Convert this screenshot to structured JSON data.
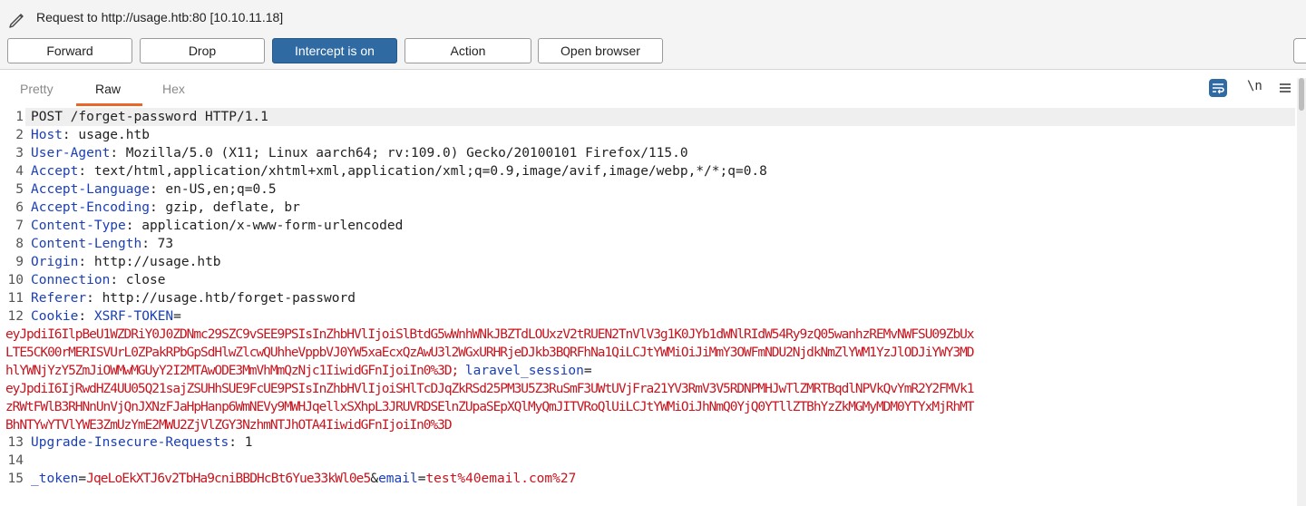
{
  "window": {
    "title": "Request to http://usage.htb:80  [10.10.11.18]"
  },
  "toolbar": {
    "forward": "Forward",
    "drop": "Drop",
    "intercept": "Intercept is on",
    "action": "Action",
    "open_browser": "Open browser"
  },
  "tabs": {
    "pretty": "Pretty",
    "raw": "Raw",
    "hex": "Hex",
    "newline_icon": "\\n",
    "active": "Raw"
  },
  "icons": {
    "pencil": "pencil-icon",
    "wrap": "wrap-text-icon",
    "newline": "newline-icon",
    "menu": "hamburger-menu-icon"
  },
  "colors": {
    "accent": "#e8682b",
    "intercept_bg": "#2f6aa3",
    "header_name": "#1a3fb8",
    "value_red": "#c8141e"
  },
  "request": {
    "line1": "POST /forget-password HTTP/1.1",
    "headers": [
      {
        "n": "2",
        "name": "Host",
        "value": " usage.htb"
      },
      {
        "n": "3",
        "name": "User-Agent",
        "value": " Mozilla/5.0 (X11; Linux aarch64; rv:109.0) Gecko/20100101 Firefox/115.0"
      },
      {
        "n": "4",
        "name": "Accept",
        "value": " text/html,application/xhtml+xml,application/xml;q=0.9,image/avif,image/webp,*/*;q=0.8"
      },
      {
        "n": "5",
        "name": "Accept-Language",
        "value": " en-US,en;q=0.5"
      },
      {
        "n": "6",
        "name": "Accept-Encoding",
        "value": " gzip, deflate, br"
      },
      {
        "n": "7",
        "name": "Content-Type",
        "value": " application/x-www-form-urlencoded"
      },
      {
        "n": "8",
        "name": "Content-Length",
        "value": " 73"
      },
      {
        "n": "9",
        "name": "Origin",
        "value": " http://usage.htb"
      },
      {
        "n": "10",
        "name": "Connection",
        "value": " close"
      },
      {
        "n": "11",
        "name": "Referer",
        "value": " http://usage.htb/forget-password"
      }
    ],
    "cookie": {
      "n": "12",
      "name": "Cookie",
      "xsrf_name": "XSRF-TOKEN",
      "xsrf_lines": [
        "eyJpdiI6IlpBeU1WZDRiY0J0ZDNmc29SZC9vSEE9PSIsInZhbHVlIjoiSlBtdG5wWnhWNkJBZTdLOUxzV2tRUEN2TnVlV3g1K0JYb1dWNlRIdW54Ry9zQ05wanhzREMvNWFSU09ZbUx",
        "LTE5CK00rMERISVUrL0ZPakRPbGpSdHlwZlcwQUhheVppbVJ0YW5xaEcxQzAwU3l2WGxURHRjeDJkb3BQRFhNa1QiLCJtYWMiOiJiMmY3OWFmNDU2NjdkNmZlYWM1YzJlODJiYWY3MD",
        "hlYWNjYzY5ZmJiOWMwMGUyY2I2MTAwODE3MmVhMmQzNjc1IiwidGFnIjoiIn0%3D;"
      ],
      "laravel_name": "laravel_session",
      "laravel_lines": [
        "eyJpdiI6IjRwdHZ4UU05Q21sajZSUHhSUE9FcUE9PSIsInZhbHVlIjoiSHlTcDJqZkRSd25PM3U5Z3RuSmF3UWtUVjFra21YV3RmV3V5RDNPMHJwTlZMRTBqdlNPVkQvYmR2Y2FMVk1",
        "zRWtFWlB3RHNnUnVjQnJXNzFJaHpHanp6WmNEVy9MWHJqellxSXhpL3JRUVRDSElnZUpaSEpXQlMyQmJITVRoQlUiLCJtYWMiOiJhNmQ0YjQ0YTllZTBhYzZkMGMyMDM0YTYxMjRhMT",
        "BhNTYwYTVlYWE3ZmUzYmE2MWU2ZjVlZGY3NzhmNTJhOTA4IiwidGFnIjoiIn0%3D"
      ]
    },
    "line13": {
      "n": "13",
      "name": "Upgrade-Insecure-Requests",
      "value": " 1"
    },
    "line14": {
      "n": "14"
    },
    "line15": {
      "n": "15",
      "token_name": "_token",
      "token_value": "JqeLoEkXTJ6v2TbHa9cniBBDHcBt6Yue33kWl0e5",
      "email_name": "email",
      "email_value": "test%40email.com%27"
    }
  }
}
